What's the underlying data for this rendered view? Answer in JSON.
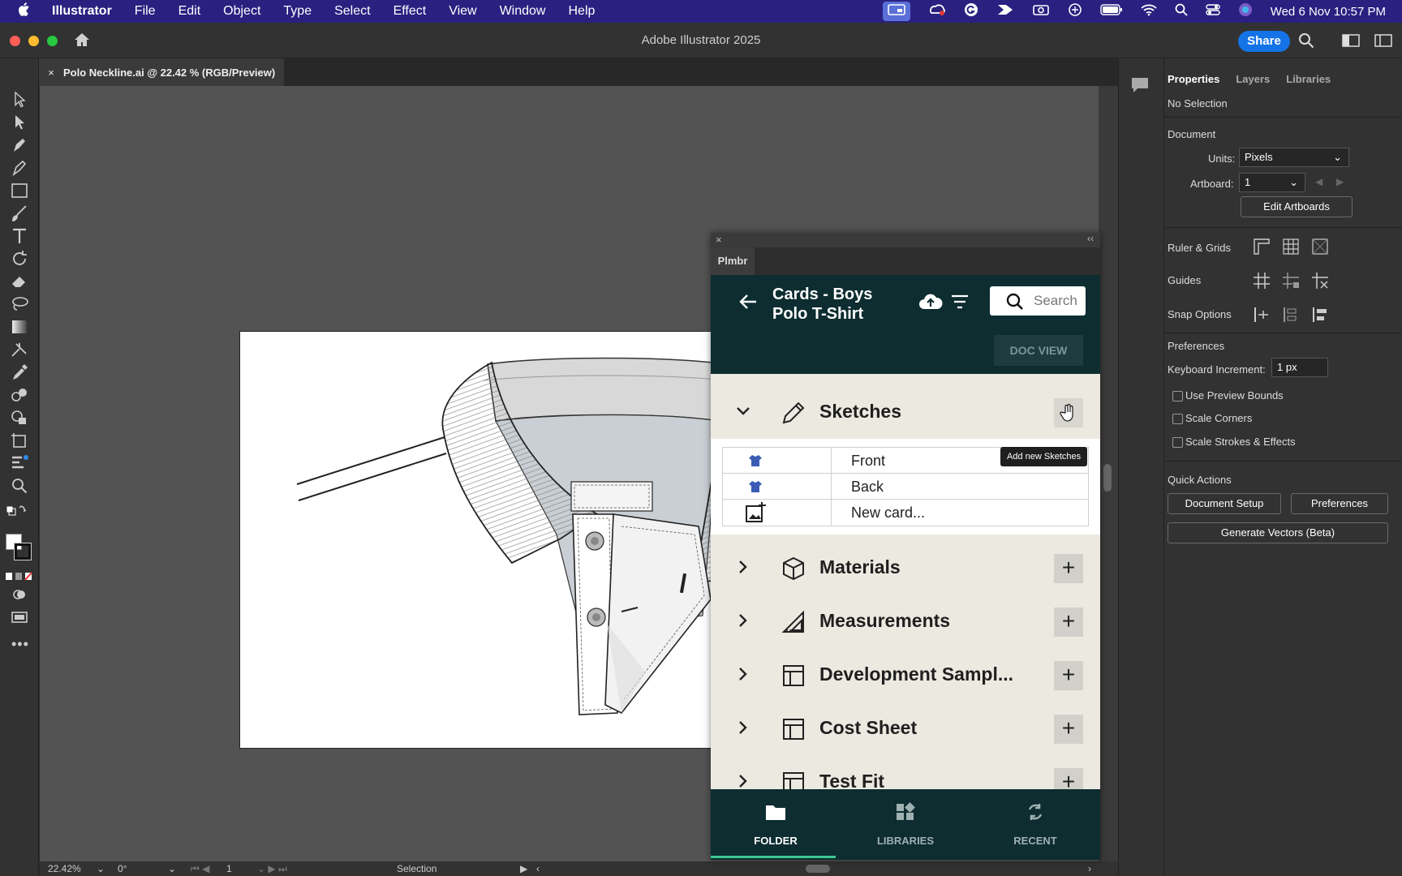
{
  "menubar": {
    "app": "Illustrator",
    "items": [
      "File",
      "Edit",
      "Object",
      "Type",
      "Select",
      "Effect",
      "View",
      "Window",
      "Help"
    ],
    "datetime": "Wed 6 Nov  10:57 PM"
  },
  "window": {
    "title": "Adobe Illustrator 2025",
    "share_label": "Share",
    "doc_tab": "Polo Neckline.ai @ 22.42 % (RGB/Preview)",
    "doc_tab_close": "×"
  },
  "status": {
    "zoom": "22.42%",
    "rotation": "0°",
    "artboard": "1",
    "tool": "Selection"
  },
  "properties": {
    "tabs": [
      "Properties",
      "Layers",
      "Libraries"
    ],
    "selection": "No Selection",
    "document_heading": "Document",
    "units_label": "Units:",
    "units_value": "Pixels",
    "artboard_label": "Artboard:",
    "artboard_value": "1",
    "edit_artboards": "Edit Artboards",
    "ruler_grids": "Ruler & Grids",
    "guides": "Guides",
    "snap_options": "Snap Options",
    "preferences_heading": "Preferences",
    "keyboard_increment_label": "Keyboard Increment:",
    "keyboard_increment_value": "1 px",
    "use_preview_bounds": "Use Preview Bounds",
    "scale_corners": "Scale Corners",
    "scale_strokes": "Scale Strokes & Effects",
    "quick_actions": "Quick Actions",
    "document_setup": "Document Setup",
    "preferences_btn": "Preferences",
    "generate_vectors": "Generate Vectors (Beta)"
  },
  "plmbr": {
    "tab": "Plmbr",
    "title": "Cards - Boys Polo T-Shirt",
    "search_placeholder": "Search",
    "doc_view": "DOC VIEW",
    "sections": {
      "sketches": "Sketches",
      "materials": "Materials",
      "measurements": "Measurements",
      "development": "Development Sampl...",
      "cost_sheet": "Cost Sheet",
      "test_fit": "Test Fit"
    },
    "cards": [
      "Front",
      "Back",
      "New card..."
    ],
    "tooltip": "Add new Sketches",
    "footer": [
      "FOLDER",
      "LIBRARIES",
      "RECENT"
    ]
  }
}
